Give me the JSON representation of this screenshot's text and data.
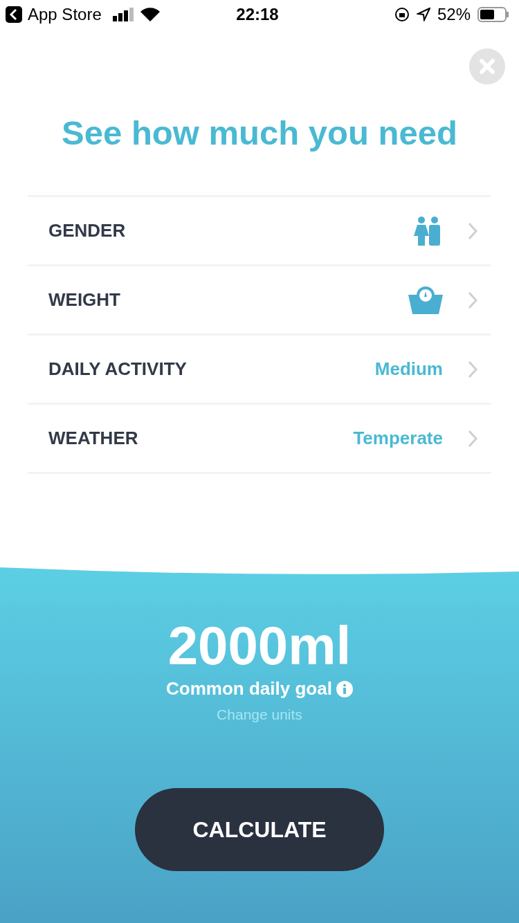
{
  "status_bar": {
    "back_label": "App Store",
    "time": "22:18",
    "battery": "52%"
  },
  "title": "See how much you need",
  "rows": [
    {
      "label": "GENDER",
      "kind": "gender"
    },
    {
      "label": "WEIGHT",
      "kind": "scale"
    },
    {
      "label": "DAILY ACTIVITY",
      "kind": "value",
      "value": "Medium"
    },
    {
      "label": "WEATHER",
      "kind": "value",
      "value": "Temperate"
    }
  ],
  "goal": {
    "amount": "2000ml",
    "caption": "Common daily goal",
    "link": "Change units"
  },
  "button": "CALCULATE"
}
